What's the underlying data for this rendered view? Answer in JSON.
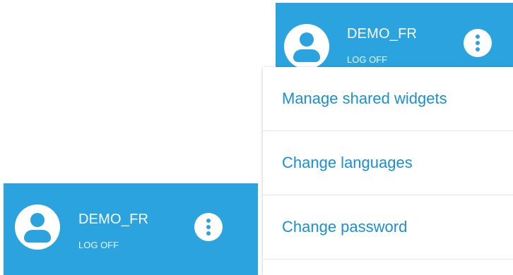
{
  "top_header": {
    "username": "DEMO_FR",
    "logoff_label": "LOG OFF"
  },
  "bottom_header": {
    "username": "DEMO_FR",
    "logoff_label": "LOG OFF"
  },
  "menu": {
    "items": [
      {
        "label": "Manage shared widgets"
      },
      {
        "label": "Change languages"
      },
      {
        "label": "Change password"
      }
    ]
  },
  "colors": {
    "accent": "#2aa3de",
    "menu_text": "#1a8fd1"
  },
  "icons": {
    "avatar": "user-avatar-icon",
    "menu": "kebab-menu-icon"
  }
}
